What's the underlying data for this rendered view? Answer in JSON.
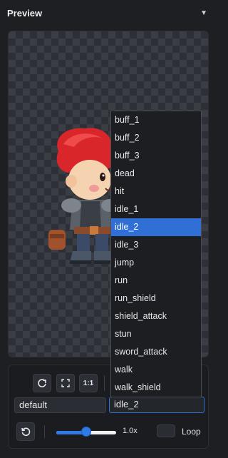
{
  "panel": {
    "title": "Preview",
    "collapse_glyph": "▼"
  },
  "controls": {
    "actual_size_label": "1:1",
    "skin_value": "default",
    "animation_value": "idle_2",
    "zoom_text": "1.0x",
    "zoom_level": 0.5,
    "loop_label": "Loop",
    "loop_checked": false
  },
  "dropdown": {
    "options": [
      "buff_1",
      "buff_2",
      "buff_3",
      "dead",
      "hit",
      "idle_1",
      "idle_2",
      "idle_3",
      "jump",
      "run",
      "run_shield",
      "shield_attack",
      "stun",
      "sword_attack",
      "walk",
      "walk_shield"
    ],
    "selected": "idle_2"
  },
  "colors": {
    "accent": "#2f6fd6",
    "background": "#1d1f23"
  }
}
